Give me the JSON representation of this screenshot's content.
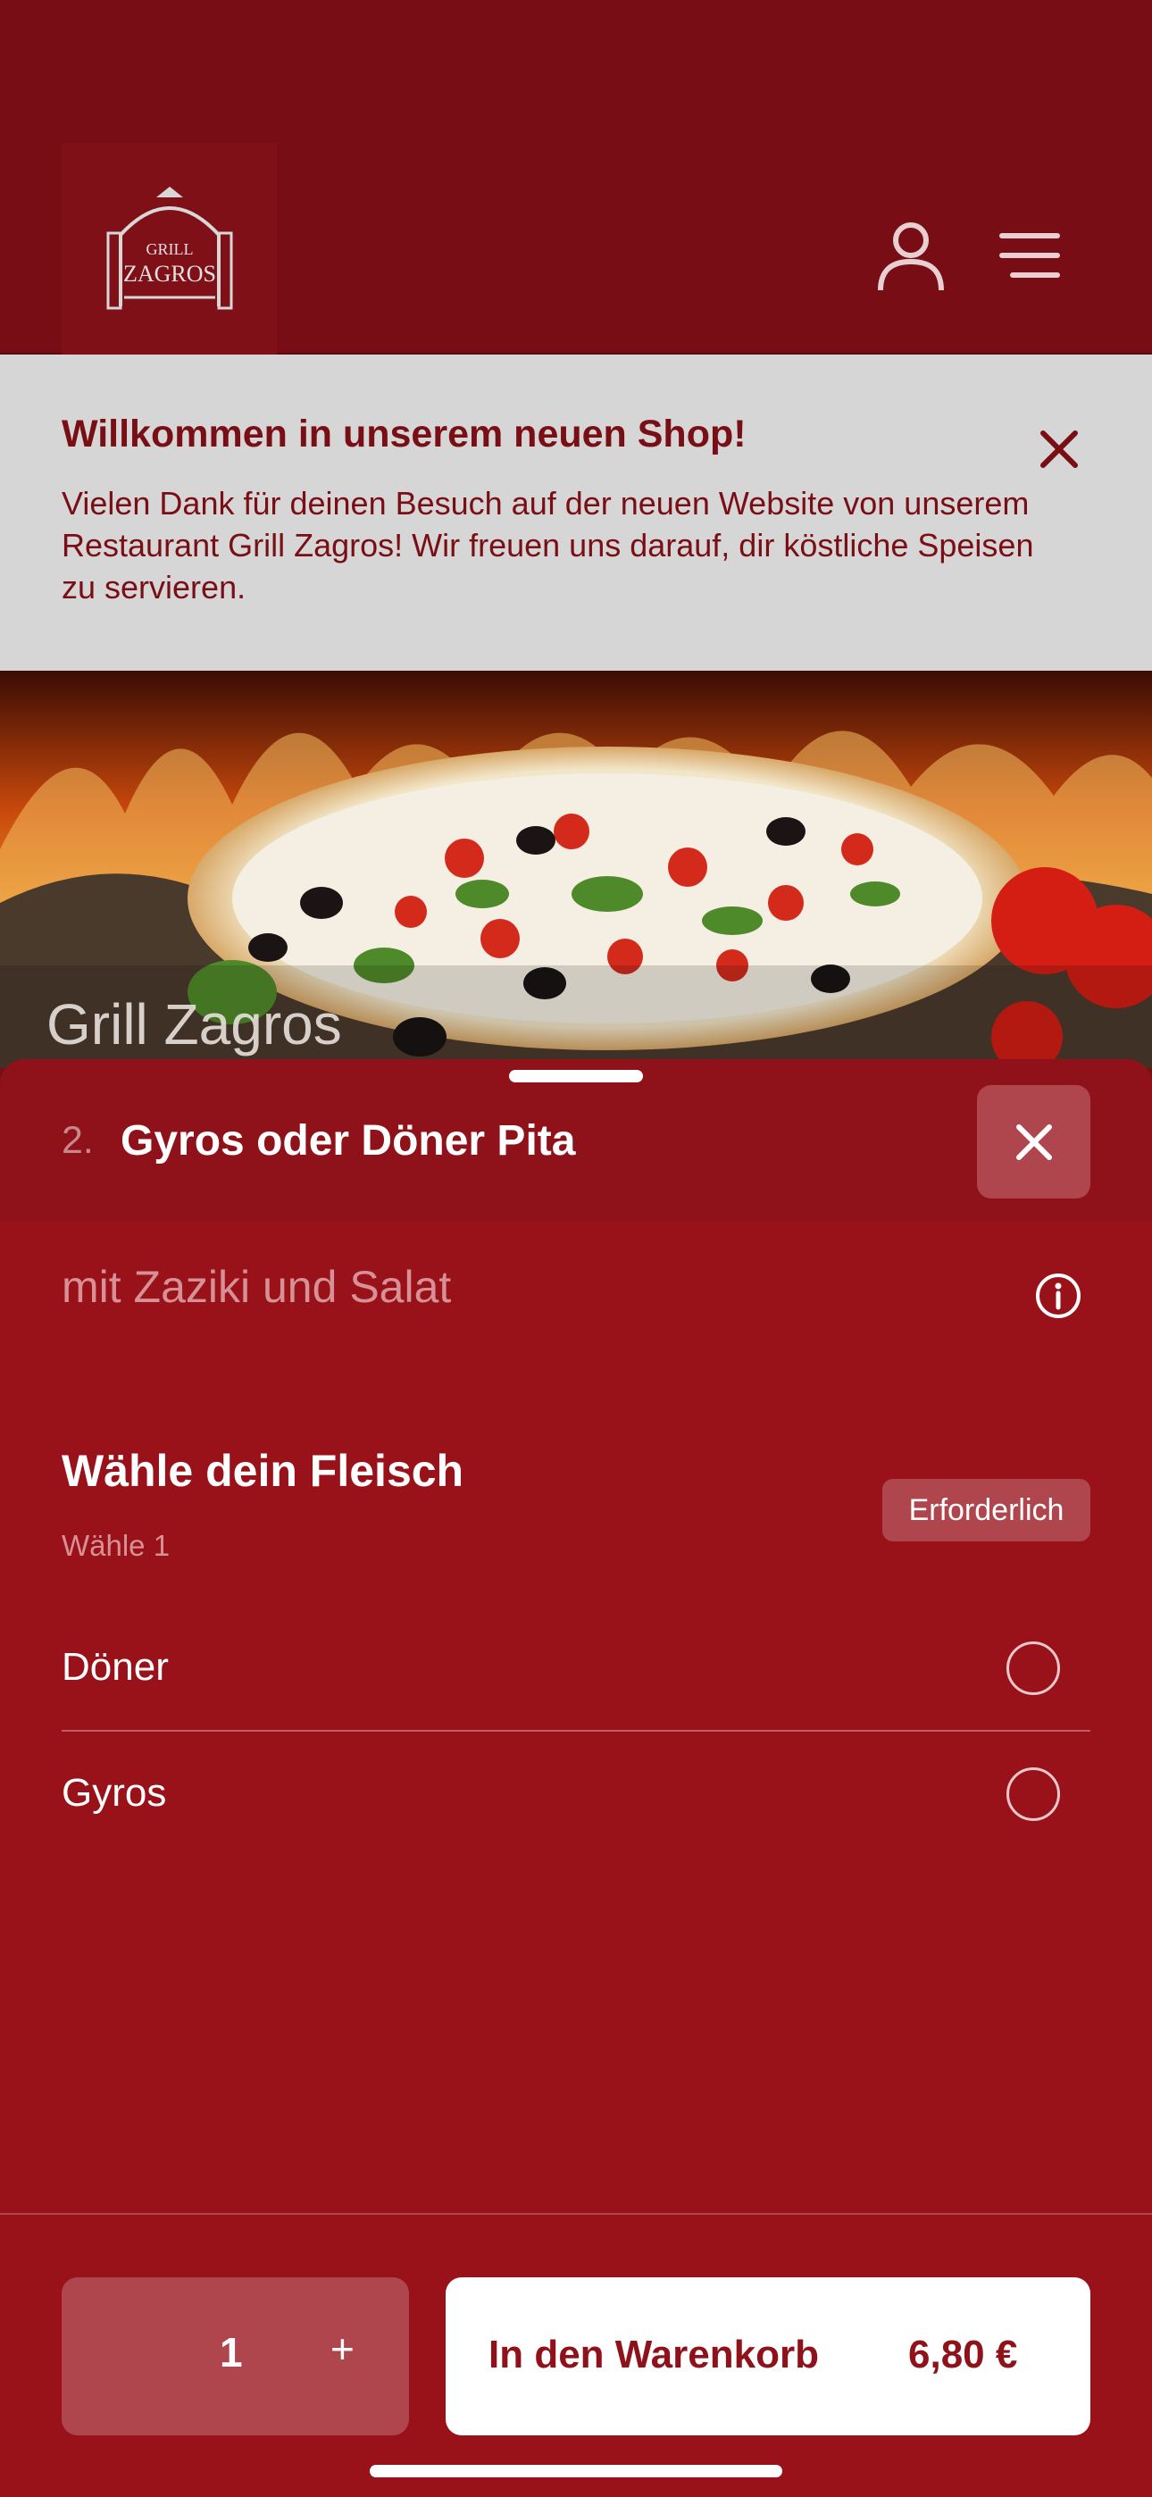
{
  "header": {
    "logo_alt": "Grill Zagros logo",
    "logo_lines": [
      "GRILL",
      "ZAGROS"
    ],
    "icons": [
      "user-icon",
      "menu-icon"
    ]
  },
  "banner": {
    "title": "Willkommen in unserem neuen Shop!",
    "text": "Vielen Dank für deinen Besuch auf der neuen Website von unserem Restaurant Grill Zagros! Wir freuen uns darauf, dir köstliche Speisen zu servieren.",
    "close_icon": "close-icon"
  },
  "hero": {
    "restaurant_name": "Grill Zagros"
  },
  "sheet": {
    "item_number": "2.",
    "item_title": "Gyros oder Döner Pita",
    "item_description": "mit Zaziki und Salat",
    "group": {
      "title": "Wähle dein Fleisch",
      "subtitle": "Wähle 1",
      "badge": "Erforderlich",
      "options": [
        {
          "label": "Döner",
          "selected": false
        },
        {
          "label": "Gyros",
          "selected": false
        }
      ]
    }
  },
  "footer": {
    "quantity": "1",
    "plus": "+",
    "cart_label": "In den Warenkorb",
    "price": "6,80 €"
  },
  "colors": {
    "brand_dark": "#780d15",
    "sheet": "#99121a",
    "accent_muted": "#b0464d",
    "banner_bg": "#d6d6d6"
  }
}
